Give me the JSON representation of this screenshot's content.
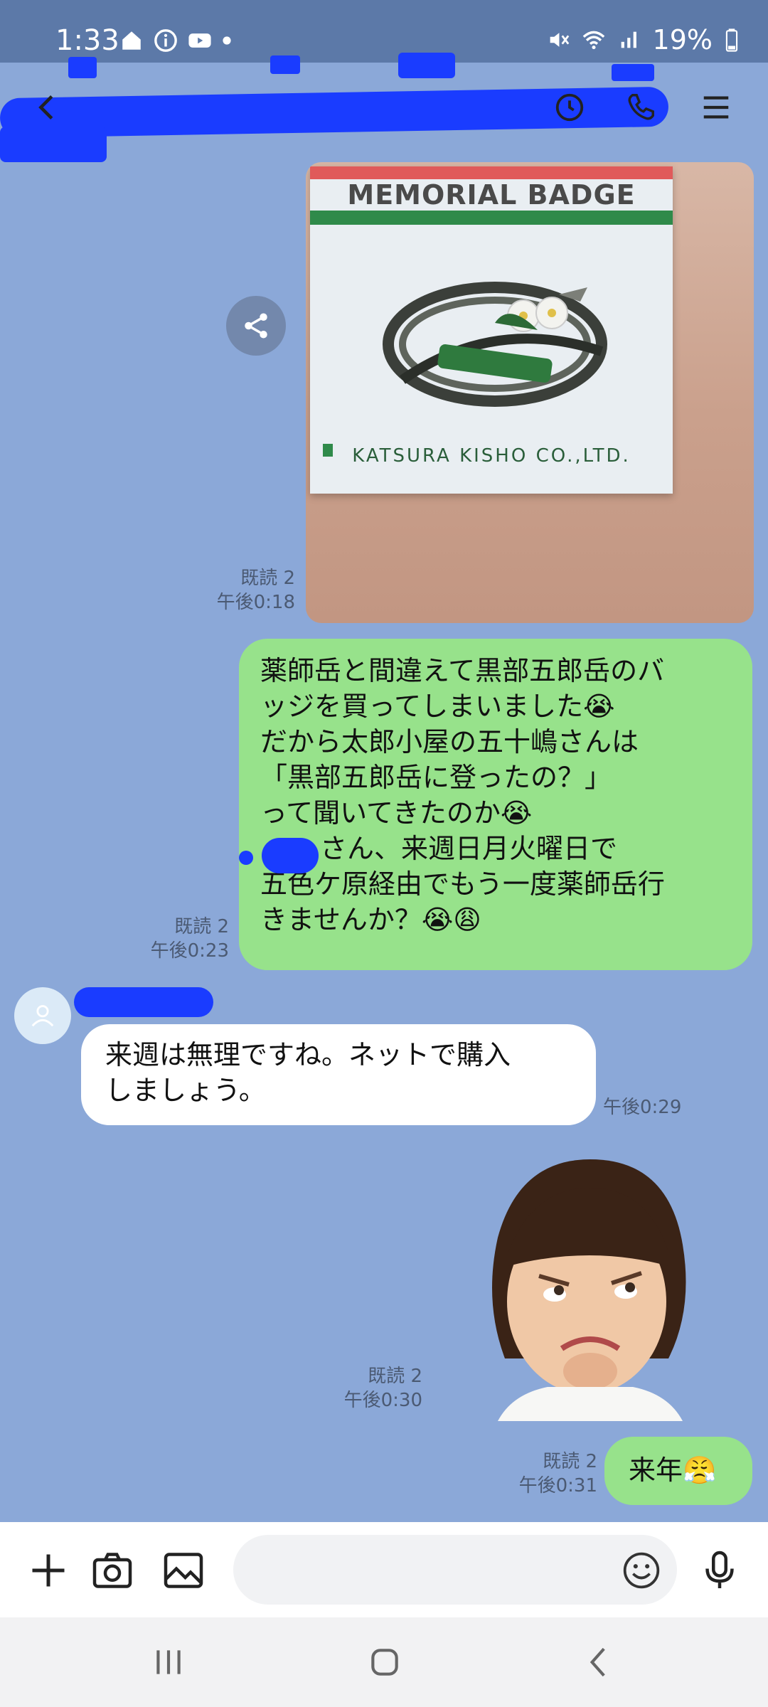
{
  "status_bar": {
    "time": "1:33",
    "battery": "19%",
    "left_icons": [
      "home-icon",
      "info-icon",
      "youtube-icon",
      "dot-icon"
    ],
    "right_icons": [
      "mute-icon",
      "wifi-icon",
      "signal-icon",
      "battery-icon"
    ]
  },
  "header": {
    "left_icon": "back-chevron-icon",
    "right_icons": [
      "clock-icon",
      "phone-icon",
      "menu-icon"
    ]
  },
  "messages": [
    {
      "type": "image",
      "direction": "outgoing",
      "read": "既読 2",
      "time": "午後0:18",
      "image": {
        "title": "MEMORIAL BADGE",
        "footer": "KATSURA  KISHO  CO.,LTD."
      }
    },
    {
      "type": "text",
      "direction": "outgoing",
      "read": "既読 2",
      "time": "午後0:23",
      "lines": [
        "薬師岳と間違えて黒部五郎岳のバ",
        "ッジを買ってしまいました😭",
        "だから太郎小屋の五十嶋さんは",
        "「黒部五郎岳に登ったの？」",
        "って聞いてきたのか😭",
        "さん、来週日月火曜日で",
        "五色ケ原経由でもう一度薬師岳行",
        "きませんか？😭😩"
      ]
    },
    {
      "type": "text",
      "direction": "incoming",
      "time": "午後0:29",
      "lines": [
        "来週は無理ですね。ネットで購入",
        "しましょう。"
      ]
    },
    {
      "type": "sticker",
      "direction": "outgoing",
      "read": "既読 2",
      "time": "午後0:30"
    },
    {
      "type": "text",
      "direction": "outgoing",
      "read": "既読 2",
      "time": "午後0:31",
      "lines": [
        "来年😤"
      ]
    }
  ],
  "input_bar": {
    "icons": [
      "plus-icon",
      "camera-icon",
      "image-icon",
      "emoji-icon",
      "mic-icon"
    ],
    "placeholder": ""
  },
  "nav_bar": {
    "icons": [
      "recent-apps-icon",
      "home-button-icon",
      "back-icon"
    ]
  },
  "colors": {
    "background": "#8ba8d8",
    "outgoing_bubble": "#97e28b",
    "incoming_bubble": "#ffffff",
    "status_bar": "#5c79a8",
    "redaction": "#1a3cff"
  }
}
